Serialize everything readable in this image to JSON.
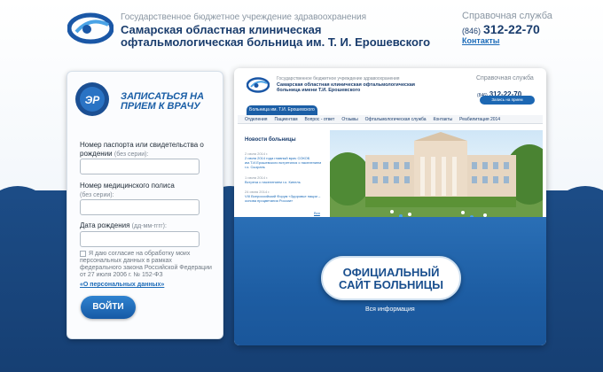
{
  "header": {
    "org_small": "Государственное бюджетное учреждение здравоохранения",
    "org_name": "Самарская областная клиническая офтальмологическая больница им. Т. И. Ерошевского",
    "help_title": "Справочная служба",
    "help_code": "(846)",
    "help_phone": "312-22-70",
    "contacts_link": "Контакты",
    "logo_icon": "eye-logo-icon"
  },
  "login_card": {
    "badge_icon": "ep-badge-icon",
    "title": "ЗАПИСАТЬСЯ НА ПРИЕМ К ВРАЧУ",
    "passport_label": "Номер паспорта или свидетельства о рождении",
    "passport_hint": "(без серии):",
    "passport_value": "",
    "policy_label": "Номер медицинского полиса",
    "policy_hint": "(без серии):",
    "policy_value": "",
    "birth_label": "Дата рождения",
    "birth_hint": "(дд-мм-гггг):",
    "birth_value": "",
    "consent_text": "Я даю согласие на обработку моих персональных данных в рамках федерального закона Российской Федерации от 27 июля 2006 г. № 152-ФЗ",
    "consent_checked": false,
    "consent_link": "«О персональных данных»",
    "login_button": "ВОЙТИ"
  },
  "preview": {
    "org_small": "Государственное бюджетное учреждение здравоохранения",
    "org_name": "Самарская областная клиническая офтальмологическая больница имени Т.И. Ерошевского",
    "help_title": "Справочная служба",
    "help_code": "(846)",
    "help_phone": "312-22-70",
    "record_button": "Запись на прием",
    "site_tab": "Больница им. Т.И. Ерошевского",
    "nav": [
      "Отделения",
      "Пациентам",
      "Вопрос - ответ",
      "Отзывы",
      "Офтальмологическая служба",
      "Контакты",
      "Реабилитация 2014"
    ],
    "news_title": "Новости больницы",
    "news": [
      {
        "date": "2 июля 2014 г.",
        "text": "2 июля 2014 года главный врач СОКОБ им.Т.И.Ерошевского встретился с населением г.о. Сызрань"
      },
      {
        "date": "1 июля 2014 г.",
        "text": "Встреча с населением г.о. Кинель"
      },
      {
        "date": "24 июня 2014 г.",
        "text": "VIII Всероссийский Форум «Здоровье нации – основа процветания России»"
      }
    ],
    "news_all": "Вся новости",
    "official_line1": "ОФИЦИАЛЬНЫЙ",
    "official_line2": "САЙТ БОЛЬНИЦЫ",
    "info_link": "Вся информация"
  },
  "colors": {
    "brand_blue": "#1a3d6d",
    "link_blue": "#1c6bb8",
    "sea_blue": "#1c4c86",
    "button_blue": "#1659a5"
  }
}
